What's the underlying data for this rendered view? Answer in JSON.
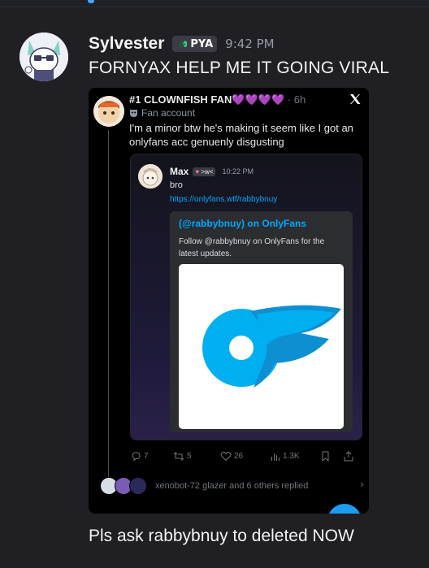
{
  "message": {
    "username": "Sylvester",
    "tag": "PYA",
    "time": "9:42 PM",
    "text_top": "FORNYAX HELP ME IT GOING VIRAL",
    "text_bottom": "Pls ask rabbybnuy to deleted NOW"
  },
  "tweet": {
    "author_name": "#1 CLOWNFISH FAN",
    "author_hearts": "💜💜💜💜",
    "time": "· 6h",
    "account_label": "Fan account",
    "text": "I'm a minor btw he's making it seem like I got an onlyfans acc genuenly disgusting",
    "screenshot": {
      "name": "Max",
      "badge": ">w<",
      "time": "10:22 PM",
      "text": "bro",
      "link": "https://onlyfans.wtf/rabbybnuy",
      "embed_title": "(@rabbybnuy) on OnlyFans",
      "embed_desc": "Follow @rabbybnuy on OnlyFans for the latest updates."
    },
    "stats": {
      "replies": "7",
      "retweets": "5",
      "likes": "26",
      "views": "1.3K"
    },
    "replies_summary": "xenobot-72 glazer and 6 others replied"
  },
  "colors": {
    "background": "#1f1f24",
    "link": "#00a8fc",
    "twitter_blue": "#1d9bf0",
    "onlyfans_blue": "#00aff0"
  }
}
